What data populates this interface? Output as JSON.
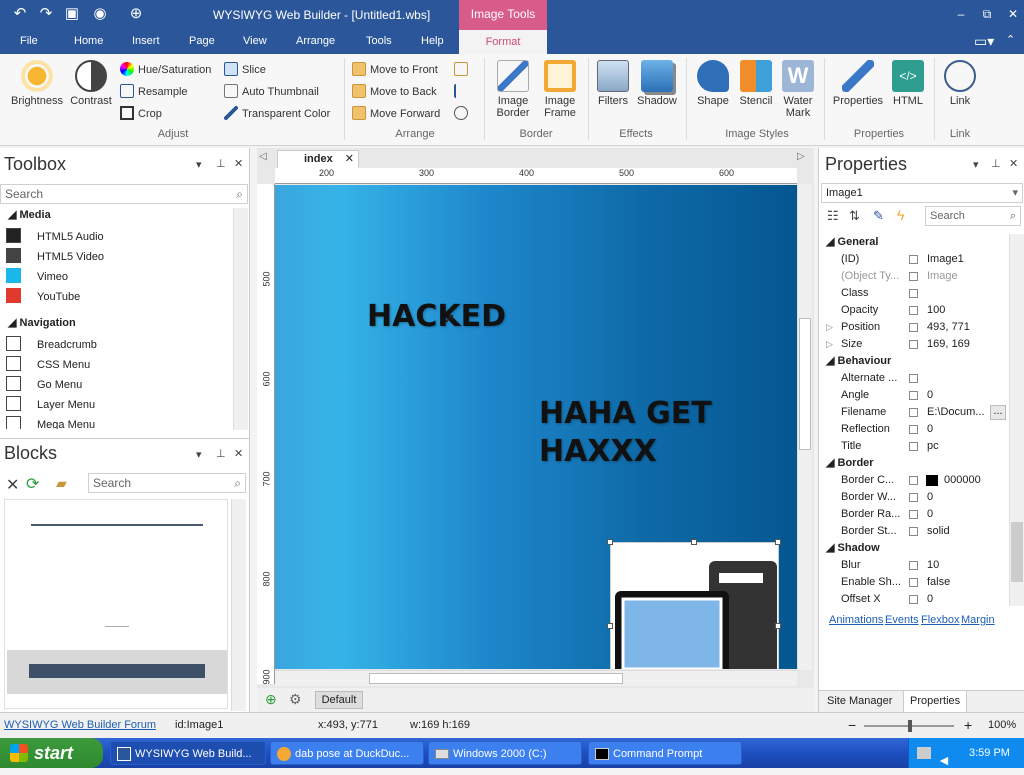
{
  "window": {
    "title": "WYSIWYG Web Builder - [Untitled1.wbs]",
    "context_tab": "Image Tools",
    "controls": [
      "–",
      "⧉",
      "✕"
    ]
  },
  "menu": [
    "File",
    "Home",
    "Insert",
    "Page",
    "View",
    "Arrange",
    "Tools",
    "Help"
  ],
  "active_tab": "Format",
  "ribbon": {
    "adjust": {
      "brightness": "Brightness",
      "contrast": "Contrast",
      "hue": "Hue/Saturation",
      "resample": "Resample",
      "crop": "Crop",
      "slice": "Slice",
      "auto_thumb": "Auto Thumbnail",
      "transparent": "Transparent Color",
      "group": "Adjust"
    },
    "arrange": {
      "front": "Move to Front",
      "back": "Move to Back",
      "forward": "Move Forward",
      "group": "Arrange"
    },
    "border": {
      "image_border": "Image Border",
      "image_frame": "Image Frame",
      "group": "Border"
    },
    "effects": {
      "filters": "Filters",
      "shadow": "Shadow",
      "group": "Effects"
    },
    "styles": {
      "shape": "Shape",
      "stencil": "Stencil",
      "watermark": "Water Mark",
      "group": "Image Styles"
    },
    "props": {
      "properties": "Properties",
      "html": "HTML",
      "group": "Properties"
    },
    "link": {
      "link": "Link",
      "group": "Link"
    }
  },
  "toolbox": {
    "title": "Toolbox",
    "search": "Search",
    "media": "Media",
    "items_media": [
      "HTML5 Audio",
      "HTML5 Video",
      "Vimeo",
      "YouTube"
    ],
    "navigation": "Navigation",
    "items_nav": [
      "Breadcrumb",
      "CSS Menu",
      "Go Menu",
      "Layer Menu",
      "Mega Menu"
    ]
  },
  "blocks": {
    "title": "Blocks",
    "search": "Search"
  },
  "editor": {
    "tab": "index",
    "ruler_h": [
      "200",
      "300",
      "400",
      "500",
      "600"
    ],
    "ruler_v": [
      "500",
      "600",
      "700",
      "800",
      "900"
    ],
    "text1": "HACKED",
    "text2_line1": "HAHA GET",
    "text2_line2": "HAXXX",
    "bottom_tab": "Default"
  },
  "properties": {
    "title": "Properties",
    "selected": "Image1",
    "search": "Search",
    "general": "General",
    "rows_general": [
      {
        "n": "(ID)",
        "v": "Image1"
      },
      {
        "n": "(Object Ty...",
        "v": "Image"
      },
      {
        "n": "Class",
        "v": ""
      },
      {
        "n": "Opacity",
        "v": "100"
      },
      {
        "n": "Position",
        "v": "493, 771"
      },
      {
        "n": "Size",
        "v": "169, 169"
      }
    ],
    "behaviour": "Behaviour",
    "rows_behaviour": [
      {
        "n": "Alternate ...",
        "v": ""
      },
      {
        "n": "Angle",
        "v": "0"
      },
      {
        "n": "Filename",
        "v": "E:\\Docum..."
      },
      {
        "n": "Reflection",
        "v": "0"
      },
      {
        "n": "Title",
        "v": "pc"
      }
    ],
    "border": "Border",
    "rows_border": [
      {
        "n": "Border C...",
        "v": "000000"
      },
      {
        "n": "Border W...",
        "v": "0"
      },
      {
        "n": "Border Ra...",
        "v": "0"
      },
      {
        "n": "Border St...",
        "v": "solid"
      }
    ],
    "shadow": "Shadow",
    "rows_shadow": [
      {
        "n": "Blur",
        "v": "10"
      },
      {
        "n": "Enable Sh...",
        "v": "false"
      },
      {
        "n": "Offset X",
        "v": "0"
      }
    ],
    "links": [
      "Animations",
      "Events",
      "Flexbox",
      "Margin"
    ],
    "bottom_tabs": [
      "Site Manager",
      "Properties"
    ]
  },
  "status": {
    "forum": "WYSIWYG Web Builder Forum",
    "id": "id:Image1",
    "xy": "x:493, y:771",
    "wh": "w:169 h:169",
    "zoom": "100%"
  },
  "taskbar": {
    "start": "start",
    "tasks": [
      "WYSIWYG Web Build...",
      "dab pose at DuckDuc...",
      "Windows 2000 (C:)",
      "Command Prompt"
    ],
    "time": "3:59 PM"
  }
}
